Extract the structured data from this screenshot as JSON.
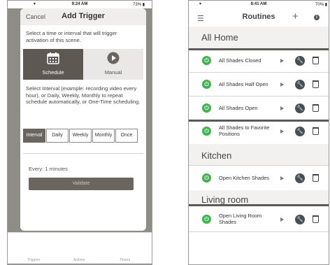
{
  "left": {
    "status": {
      "time": "9:24 AM",
      "battery": "73%"
    },
    "header": {
      "cancel": "Cancel",
      "title": "Add Trigger"
    },
    "intro": "Select a time or interval that will trigger activation of this scene.",
    "modes": [
      {
        "label": "Schedule",
        "icon": "calendar-icon",
        "selected": true
      },
      {
        "label": "Manual",
        "icon": "play-icon",
        "selected": false
      }
    ],
    "description": "Select Interval (example: recording video every hour), or Daily, Weekly, Monthly to repeat schedule automatically, or One-Time scheduling.",
    "segments": [
      {
        "label": "Interval",
        "active": true
      },
      {
        "label": "Daily",
        "active": false
      },
      {
        "label": "Weekly",
        "active": false
      },
      {
        "label": "Monthly",
        "active": false
      },
      {
        "label": "Once",
        "active": false
      }
    ],
    "every": "Every: 1 minutes",
    "validate": "Validate",
    "tabs": [
      "Triggers",
      "Actions",
      "Timers"
    ]
  },
  "right": {
    "status": {
      "time": "8:41 AM",
      "battery": "70%"
    },
    "header": {
      "title": "Routines",
      "plus": "+",
      "info": "i"
    },
    "sections": [
      {
        "title": "All Home",
        "items": [
          "All Shades Closed",
          "All Shades Half Open",
          "All Shades Open",
          "All Shades to Favorite Positions"
        ]
      },
      {
        "title": "Kitchen",
        "items": [
          "Open Kitchen Shades"
        ]
      },
      {
        "title": "Living room",
        "items": [
          "Open Living Room Shades"
        ]
      }
    ],
    "colors": {
      "power": "#3cb44b",
      "accent": "#6a655e"
    }
  }
}
